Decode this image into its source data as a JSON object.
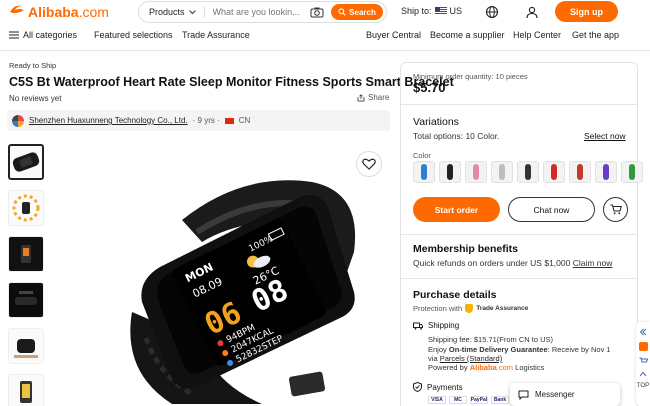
{
  "header": {
    "logo_main": "Alibaba",
    "logo_suffix": ".com",
    "search": {
      "category": "Products",
      "placeholder": "What are you lookin...",
      "button": "Search"
    },
    "ship_to_label": "Ship to:",
    "ship_to_country": "US",
    "signup": "Sign up"
  },
  "nav": {
    "all_categories": "All categories",
    "featured": "Featured selections",
    "trade": "Trade Assurance",
    "buyer": "Buyer Central",
    "supplier": "Become a supplier",
    "help": "Help Center",
    "app": "Get the app"
  },
  "product": {
    "ready": "Ready to Ship",
    "title": "C5S Bt Waterproof Heart Rate Sleep Monitor Fitness Sports Smart Bracelet",
    "reviews": "No reviews yet",
    "share": "Share",
    "supplier_name": "Shenzhen Huaxunneng Technology Co., Ltd.",
    "supplier_years": "· 9 yrs ·",
    "supplier_country": "CN",
    "watch_screen": {
      "mon": "MON",
      "battery": "100%",
      "date": "08.09",
      "temp": "26°C",
      "time_h": "06",
      "time_m": "08",
      "bpm": "94BPM",
      "kcal": "2047KCAL",
      "steps": "52832STEP"
    }
  },
  "order": {
    "moq": "Minimum order quantity: 10 pieces",
    "price": "$5.70",
    "variations_title": "Variations",
    "total_options": "Total options: 10 Color.",
    "select_now": "Select now",
    "color_label": "Color",
    "swatch_colors": [
      "#2a7fd4",
      "#222222",
      "#e58aa6",
      "#bdbdbd",
      "#333333",
      "#d42a2a",
      "#c0392b",
      "#6a3cc9",
      "#2e9b3e"
    ],
    "start_order": "Start order",
    "chat_now": "Chat now",
    "membership_title": "Membership benefits",
    "membership_text": "Quick refunds on orders under US $1,000",
    "claim_now": "Claim now",
    "purchase_title": "Purchase details",
    "protection_prefix": "Protection with",
    "protection_brand": "Trade Assurance",
    "shipping_label": "Shipping",
    "shipping_fee": "Shipping fee: $15.71(From CN to US)",
    "enjoy_prefix": "Enjoy",
    "on_time": "On-time Delivery Guarantee",
    "receive": ": Receive by Nov 1",
    "via": "via",
    "parcels": "Parcels (Standard)",
    "powered_by": "Powered by",
    "powered_brand": "Alibaba",
    "powered_suffix": ".com",
    "powered_logistics": "Logistics",
    "payments_label": "Payments",
    "payment_methods": [
      "VISA",
      "MC",
      "PayPal",
      "Bank"
    ]
  },
  "messenger": "Messenger",
  "siderail_top": "TOP"
}
